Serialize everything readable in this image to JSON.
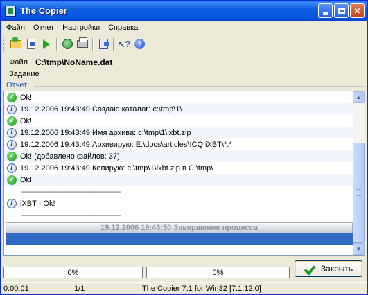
{
  "window": {
    "title": "The Copier"
  },
  "menu": [
    "Файл",
    "Отчет",
    "Настройки",
    "Справка"
  ],
  "toolbar": {
    "icons": [
      "open-folder-icon",
      "edit-task-icon",
      "run-icon",
      "refresh-icon",
      "print-icon",
      "exit-icon",
      "context-help-icon",
      "help-icon"
    ]
  },
  "file": {
    "label": "Файл",
    "path": "C:\\tmp\\NoName.dat"
  },
  "task": {
    "label": "Задание"
  },
  "report": {
    "label": "Отчет"
  },
  "log": {
    "rows": [
      {
        "icon": "ok",
        "text": "Ok!"
      },
      {
        "icon": "info",
        "text": "19.12.2006 19:43:49  Создаю каталог: c:\\tmp\\1\\"
      },
      {
        "icon": "ok",
        "text": "Ok!"
      },
      {
        "icon": "info",
        "text": "19.12.2006 19:43:49  Имя архива: c:\\tmp\\1\\ixbt.zip"
      },
      {
        "icon": "info",
        "text": "19.12.2006 19:43:49  Архивирую: E:\\docs\\articles\\ICQ iXBT\\*.*"
      },
      {
        "icon": "ok",
        "text": "Ok! (добавлено файлов: 37)"
      },
      {
        "icon": "info",
        "text": "19.12.2006 19:43:49  Копирую: c:\\tmp\\1\\ixbt.zip в C:\\tmp\\"
      },
      {
        "icon": "ok",
        "text": "Ok!"
      }
    ],
    "divider": "------------------------------------------------------",
    "result_text": "iXBT - Ok!",
    "summary": "19.12.2006 19:43:50   Завершение процесса"
  },
  "progress": {
    "file_percent": "0%",
    "total_percent": "0%",
    "file_fraction": 0,
    "total_fraction": 0
  },
  "close_button": {
    "label": "Закрыть"
  },
  "status": {
    "elapsed": "0:00:01",
    "count": "1/1",
    "version": "The Copier 7.1 for Win32   [7.1.12.0]"
  }
}
